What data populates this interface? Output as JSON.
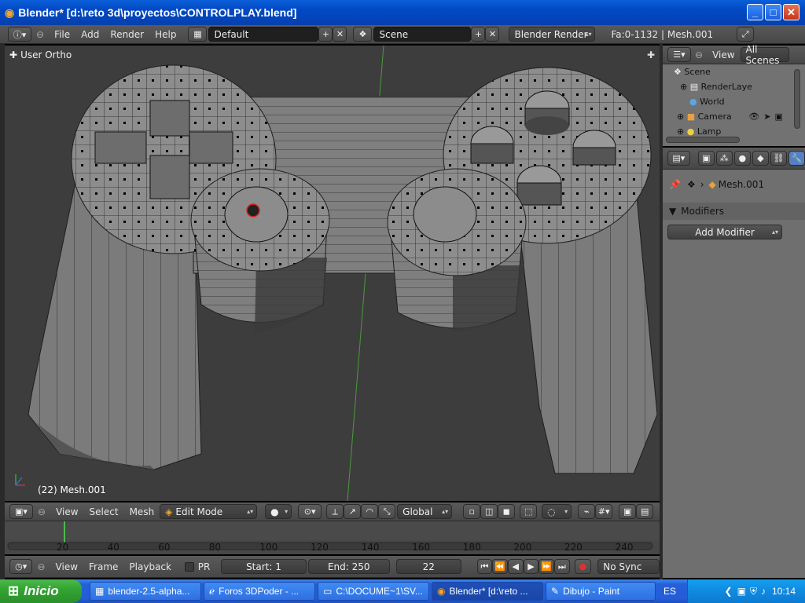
{
  "window": {
    "title": "Blender* [d:\\reto 3d\\proyectos\\CONTROLPLAY.blend]"
  },
  "info_header": {
    "menus": [
      "File",
      "Add",
      "Render",
      "Help"
    ],
    "layout": "Default",
    "scene": "Scene",
    "engine": "Blender Render",
    "stats": "Fa:0-1132 | Mesh.001"
  },
  "viewport": {
    "view_label": "User Ortho",
    "object_label": "(22) Mesh.001",
    "header": {
      "menus": [
        "View",
        "Select",
        "Mesh"
      ],
      "mode": "Edit Mode",
      "orientation": "Global"
    }
  },
  "outliner": {
    "view_menu": "View",
    "filter": "All Scenes",
    "items": [
      "Scene",
      "RenderLaye",
      "World",
      "Camera",
      "Lamp"
    ]
  },
  "properties": {
    "object_name": "Mesh.001",
    "section": "Modifiers",
    "add_button": "Add Modifier"
  },
  "timeline": {
    "ticks": [
      "20",
      "40",
      "60",
      "80",
      "100",
      "120",
      "140",
      "160",
      "180",
      "200",
      "220",
      "240"
    ],
    "menus": [
      "View",
      "Frame",
      "Playback"
    ],
    "pr_label": "PR",
    "start": "Start: 1",
    "end": "End: 250",
    "current": "22",
    "sync": "No Sync"
  },
  "taskbar": {
    "start": "Inicio",
    "tasks": [
      "blender-2.5-alpha...",
      "Foros 3DPoder - ...",
      "C:\\DOCUME~1\\SV...",
      "Blender* [d:\\reto ...",
      "Dibujo - Paint"
    ],
    "lang": "ES",
    "clock": "10:14"
  },
  "colors": {
    "viewport_bg": "#3d3d3d",
    "mesh": "#8a8a8a",
    "panel": "#6f6f6f",
    "xp_blue": "#245dd7"
  }
}
